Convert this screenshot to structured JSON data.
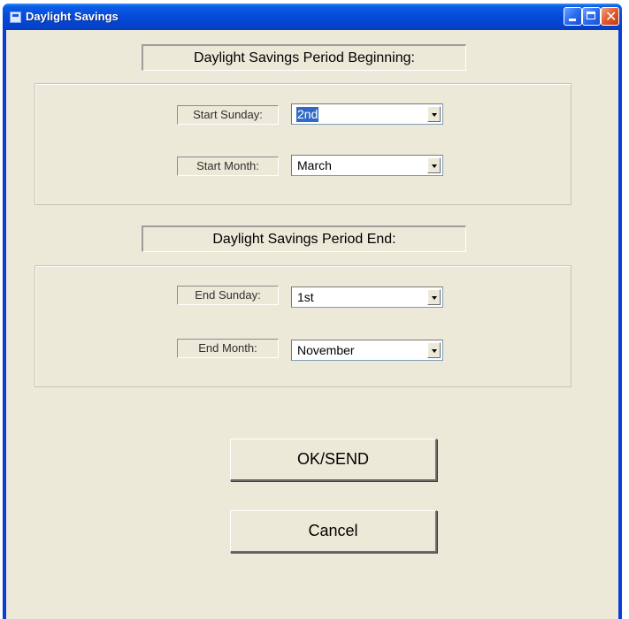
{
  "window": {
    "title": "Daylight Savings",
    "minimize_icon": "minimize-icon",
    "maximize_icon": "maximize-icon",
    "close_icon": "close-icon",
    "colors": {
      "titlebar": "#0548d8",
      "client": "#ece9d8",
      "selection": "#316ac5",
      "close": "#e05a2c"
    }
  },
  "beginning": {
    "header": "Daylight Savings Period Beginning:",
    "start_sunday_label": "Start Sunday:",
    "start_sunday_value": "2nd",
    "start_month_label": "Start Month:",
    "start_month_value": "March"
  },
  "end": {
    "header": "Daylight Savings Period End:",
    "end_sunday_label": "End Sunday:",
    "end_sunday_value": "1st",
    "end_month_label": "End Month:",
    "end_month_value": "November"
  },
  "buttons": {
    "ok_label": "OK/SEND",
    "cancel_label": "Cancel"
  }
}
